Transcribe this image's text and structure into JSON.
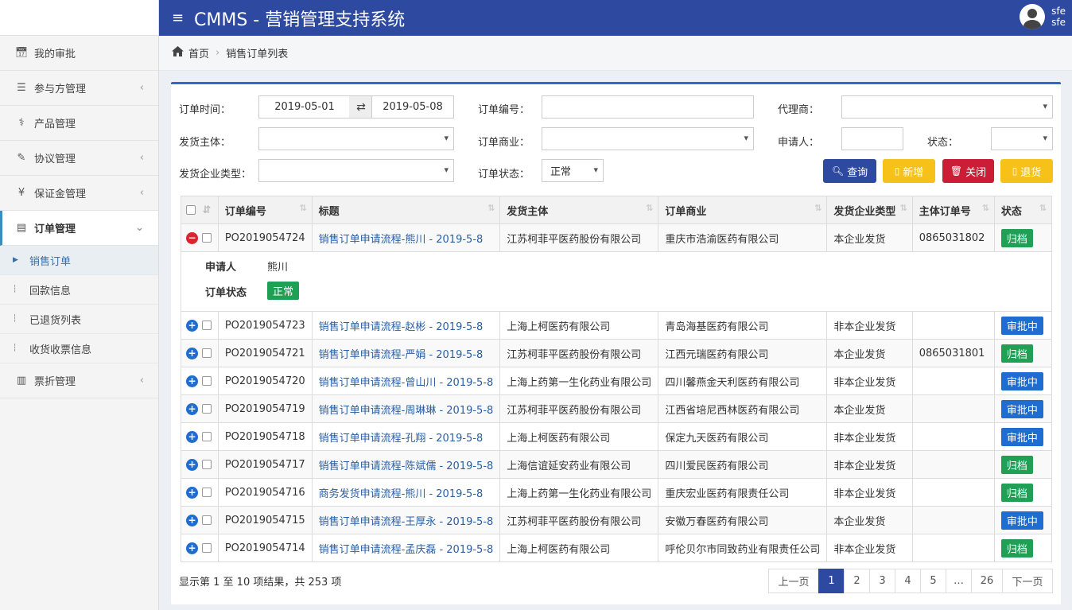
{
  "app": {
    "title": "CMMS - 营销管理支持系统",
    "menu_icon": "hamburger-icon"
  },
  "user": {
    "name": "sfe",
    "role": "sfe"
  },
  "sidebar": {
    "items": [
      {
        "label": "我的审批",
        "icon": "calendar-icon",
        "arrow": ""
      },
      {
        "label": "参与方管理",
        "icon": "list-icon",
        "arrow": "‹"
      },
      {
        "label": "产品管理",
        "icon": "medkit-icon",
        "arrow": ""
      },
      {
        "label": "协议管理",
        "icon": "edit-icon",
        "arrow": "‹"
      },
      {
        "label": "保证金管理",
        "icon": "yen-icon",
        "arrow": "‹"
      },
      {
        "label": "订单管理",
        "icon": "file-icon",
        "arrow": "⌄"
      }
    ],
    "subitems": [
      {
        "label": "销售订单"
      },
      {
        "label": "回款信息"
      },
      {
        "label": "已退货列表"
      },
      {
        "label": "收货收票信息"
      }
    ],
    "last_item": {
      "label": "票折管理",
      "icon": "pdf-icon",
      "arrow": "‹"
    }
  },
  "breadcrumb": {
    "home": "首页",
    "current": "销售订单列表"
  },
  "filters": {
    "order_time_label": "订单时间：",
    "date_from": "2019-05-01",
    "date_to": "2019-05-08",
    "order_no_label": "订单编号：",
    "order_no_value": "",
    "agent_label": "代理商：",
    "shipper_label": "发货主体：",
    "commercial_label": "订单商业：",
    "applicant_label": "申请人：",
    "status_label": "状态：",
    "ship_type_label": "发货企业类型：",
    "order_status_label": "订单状态：",
    "order_status_value": "正常"
  },
  "buttons": {
    "query": "查询",
    "add": "新增",
    "close": "关闭",
    "return": "退货"
  },
  "colors": {
    "primary": "#2d4aa0",
    "query": "#2d4aa0",
    "add": "#f6c118",
    "close": "#cc1d36",
    "return": "#f6c118",
    "archived": "#1fa055",
    "approving": "#1f6dd0"
  },
  "table": {
    "headers": [
      "订单编号",
      "标题",
      "发货主体",
      "订单商业",
      "发货企业类型",
      "主体订单号",
      "状态"
    ],
    "detail": {
      "applicant_label": "申请人",
      "applicant": "熊川",
      "status_label": "订单状态",
      "status": "正常"
    },
    "rows": [
      {
        "no": "PO2019054724",
        "title": "销售订单申请流程-熊川 - 2019-5-8",
        "shipper": "江苏柯菲平医药股份有限公司",
        "commercial": "重庆市浩渝医药有限公司",
        "type": "本企业发货",
        "main_no": "0865031802",
        "status": "归档",
        "expanded": true
      },
      {
        "no": "PO2019054723",
        "title": "销售订单申请流程-赵彬 - 2019-5-8",
        "shipper": "上海上柯医药有限公司",
        "commercial": "青岛海基医药有限公司",
        "type": "非本企业发货",
        "main_no": "",
        "status": "审批中"
      },
      {
        "no": "PO2019054721",
        "title": "销售订单申请流程-严娟 - 2019-5-8",
        "shipper": "江苏柯菲平医药股份有限公司",
        "commercial": "江西元瑞医药有限公司",
        "type": "本企业发货",
        "main_no": "0865031801",
        "status": "归档"
      },
      {
        "no": "PO2019054720",
        "title": "销售订单申请流程-曾山川 - 2019-5-8",
        "shipper": "上海上药第一生化药业有限公司",
        "commercial": "四川馨燕金天利医药有限公司",
        "type": "非本企业发货",
        "main_no": "",
        "status": "审批中"
      },
      {
        "no": "PO2019054719",
        "title": "销售订单申请流程-周琳琳 - 2019-5-8",
        "shipper": "江苏柯菲平医药股份有限公司",
        "commercial": "江西省培尼西林医药有限公司",
        "type": "本企业发货",
        "main_no": "",
        "status": "审批中"
      },
      {
        "no": "PO2019054718",
        "title": "销售订单申请流程-孔翔 - 2019-5-8",
        "shipper": "上海上柯医药有限公司",
        "commercial": "保定九天医药有限公司",
        "type": "非本企业发货",
        "main_no": "",
        "status": "审批中"
      },
      {
        "no": "PO2019054717",
        "title": "销售订单申请流程-陈斌儒 - 2019-5-8",
        "shipper": "上海信谊延安药业有限公司",
        "commercial": "四川爱民医药有限公司",
        "type": "非本企业发货",
        "main_no": "",
        "status": "归档"
      },
      {
        "no": "PO2019054716",
        "title": "商务发货申请流程-熊川 - 2019-5-8",
        "shipper": "上海上药第一生化药业有限公司",
        "commercial": "重庆宏业医药有限责任公司",
        "type": "非本企业发货",
        "main_no": "",
        "status": "归档"
      },
      {
        "no": "PO2019054715",
        "title": "销售订单申请流程-王厚永 - 2019-5-8",
        "shipper": "江苏柯菲平医药股份有限公司",
        "commercial": "安徽万春医药有限公司",
        "type": "本企业发货",
        "main_no": "",
        "status": "审批中"
      },
      {
        "no": "PO2019054714",
        "title": "销售订单申请流程-孟庆磊 - 2019-5-8",
        "shipper": "上海上柯医药有限公司",
        "commercial": "呼伦贝尔市同致药业有限责任公司",
        "type": "非本企业发货",
        "main_no": "",
        "status": "归档"
      }
    ]
  },
  "footer": {
    "summary": "显示第 1 至 10 项结果，共 253 项"
  },
  "pagination": {
    "prev": "上一页",
    "next": "下一页",
    "pages": [
      "1",
      "2",
      "3",
      "4",
      "5",
      "…",
      "26"
    ],
    "current": "1"
  }
}
